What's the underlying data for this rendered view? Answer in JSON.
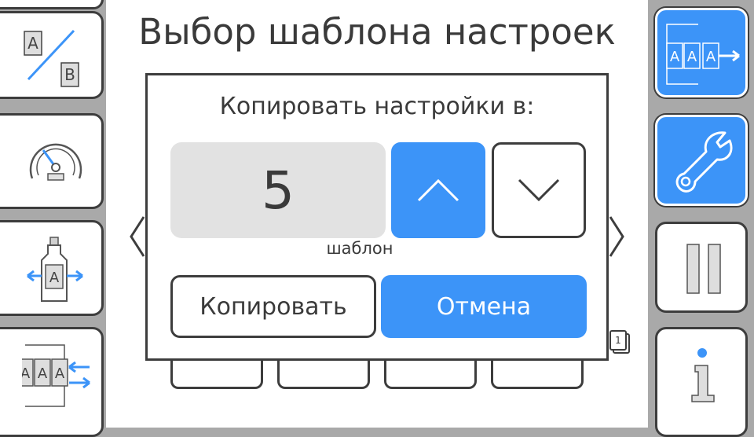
{
  "header": {
    "title": "Выбор шаблона настроек"
  },
  "dialog": {
    "title": "Копировать настройки в:",
    "value": "5",
    "unit": "шаблон",
    "copy_label": "Копировать",
    "cancel_label": "Отмена"
  },
  "left_sidebar": {
    "items": [
      {
        "icon": "template-compare-icon",
        "labels": [
          "A",
          "B"
        ]
      },
      {
        "icon": "gauge-icon"
      },
      {
        "icon": "bottle-move-icon",
        "labels": [
          "A"
        ]
      },
      {
        "icon": "templates-shift-left-icon",
        "labels": [
          "A",
          "A",
          "A"
        ]
      }
    ]
  },
  "right_sidebar": {
    "items": [
      {
        "icon": "templates-shift-right-icon",
        "labels": [
          "A",
          "A",
          "A"
        ],
        "active": true
      },
      {
        "icon": "wrench-icon",
        "active": true
      },
      {
        "icon": "pause-icon"
      },
      {
        "icon": "info-icon"
      }
    ]
  },
  "page_badge": "1",
  "colors": {
    "accent": "#3c94f8",
    "frame": "#a9a9a9",
    "stroke": "#3d3d3d",
    "value_bg": "#e2e2e2"
  }
}
